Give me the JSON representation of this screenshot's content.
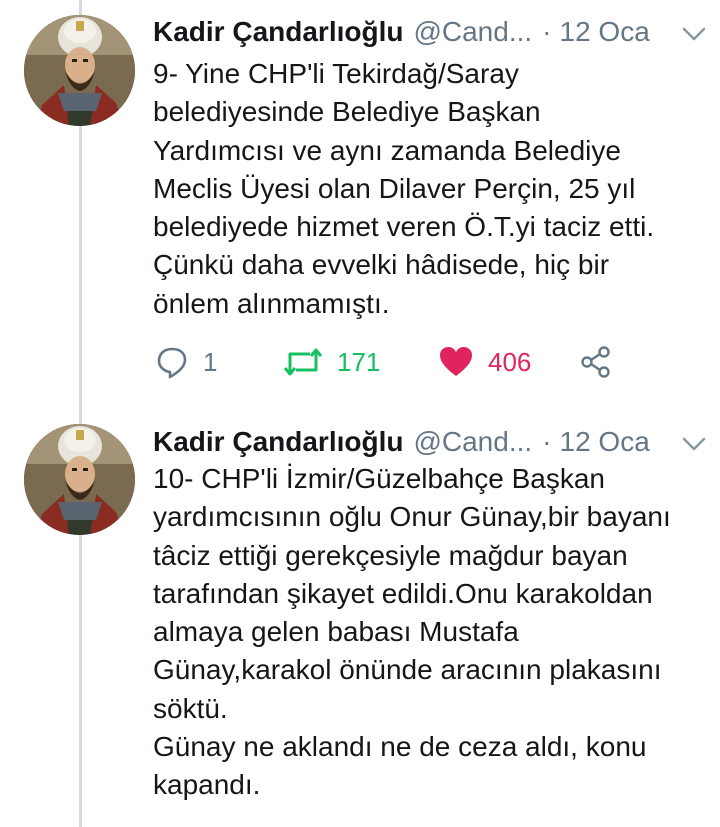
{
  "colors": {
    "retweet_active": "#17bf63",
    "like_active": "#e0245e",
    "secondary_text": "#657786",
    "thread_line": "#d3dbe2"
  },
  "tweets": [
    {
      "author": "Kadir Çandarlıoğlu",
      "handle": "@Cand...",
      "separator": "·",
      "time": "12 Oca",
      "text": "9- Yine CHP'li Tekirdağ/Saray\nbelediyesinde Belediye Başkan\nYardımcısı ve aynı zamanda Belediye\nMeclis Üyesi olan Dilaver Perçin, 25 yıl\nbelediyede hizmet veren Ö.T.yi taciz etti.\nÇünkü daha evvelki hâdisede, hiç bir\nönlem alınmamıştı.",
      "actions": {
        "reply_count": "1",
        "retweet_count": "171",
        "like_count": "406"
      },
      "icons": [
        "reply-icon",
        "retweet-icon",
        "heart-icon",
        "share-icon",
        "chevron-down-icon"
      ]
    },
    {
      "author": "Kadir Çandarlıoğlu",
      "handle": "@Cand...",
      "separator": "·",
      "time": "12 Oca",
      "text": "10- CHP'li İzmir/Güzelbahçe Başkan\nyardımcısının oğlu Onur Günay,bir bayanı\ntâciz ettiği gerekçesiyle mağdur bayan\ntarafından şikayet edildi.Onu karakoldan\nalmaya gelen babası Mustafa\nGünay,karakol önünde aracının plakasını\nsöktü.\nGünay ne aklandı ne de ceza aldı, konu\nkapandı.",
      "icons": [
        "chevron-down-icon"
      ]
    }
  ]
}
